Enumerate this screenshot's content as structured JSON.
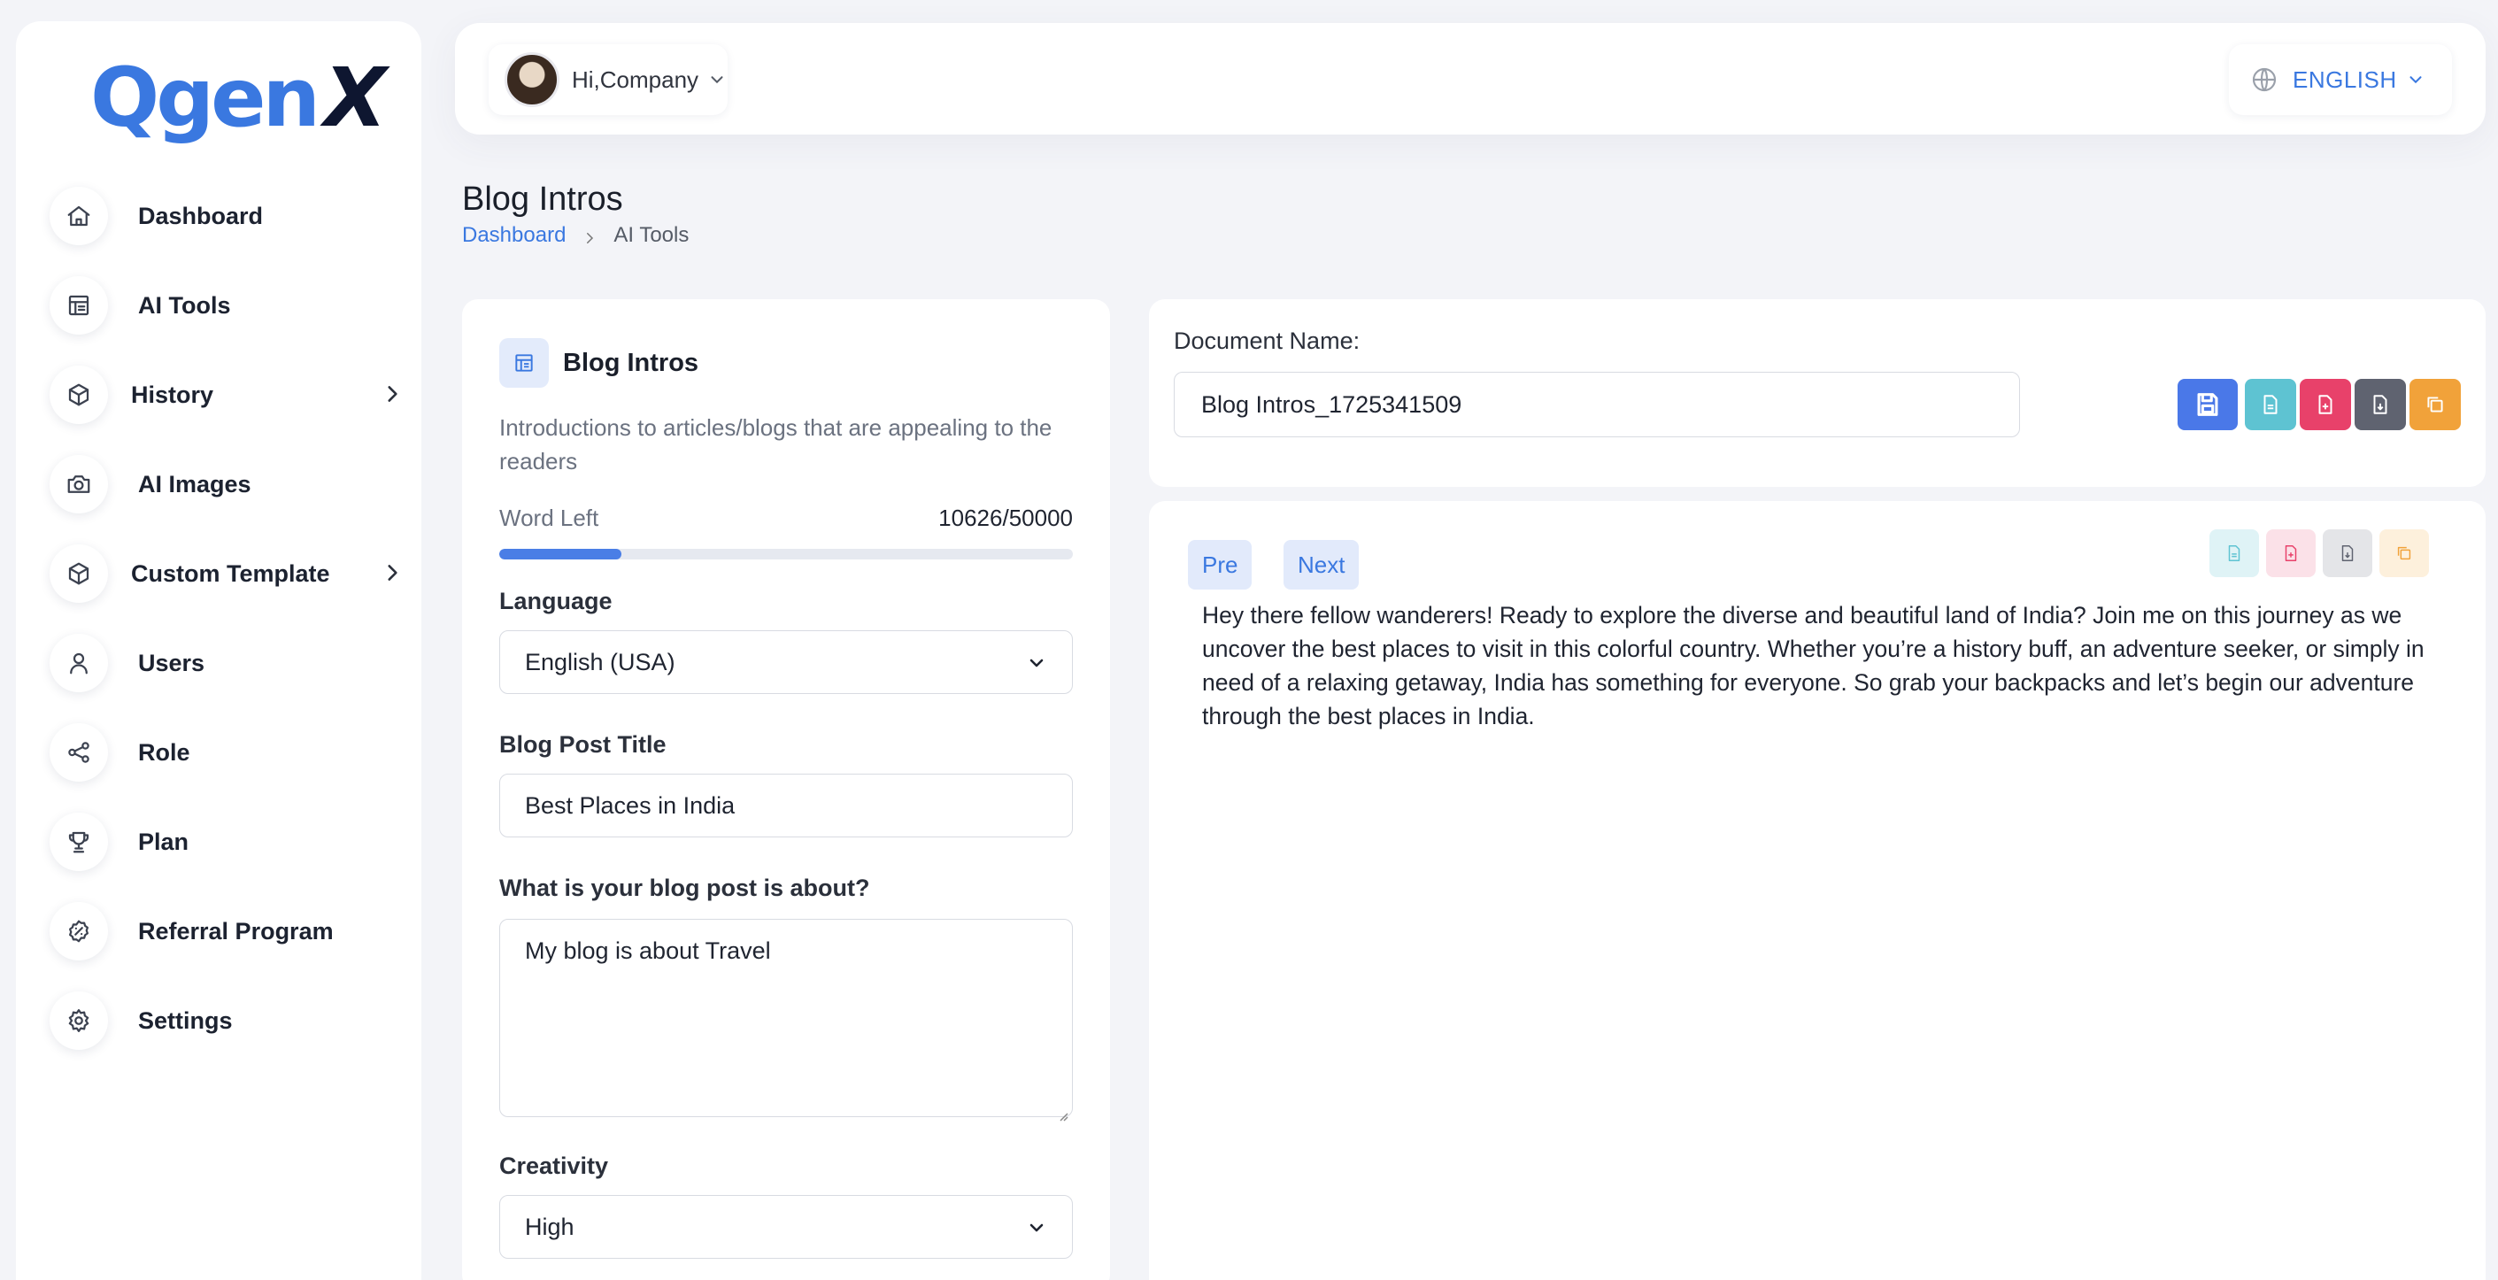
{
  "brand": {
    "logo_main": "Qgen",
    "logo_accent": "X"
  },
  "sidebar": {
    "items": [
      {
        "label": "Dashboard",
        "icon": "home-icon"
      },
      {
        "label": "AI Tools",
        "icon": "tools-icon"
      },
      {
        "label": "History",
        "icon": "box-icon",
        "has_submenu": true
      },
      {
        "label": "AI Images",
        "icon": "camera-icon"
      },
      {
        "label": "Custom Template",
        "icon": "box-icon",
        "has_submenu": true
      },
      {
        "label": "Users",
        "icon": "user-icon"
      },
      {
        "label": "Role",
        "icon": "share-icon"
      },
      {
        "label": "Plan",
        "icon": "trophy-icon"
      },
      {
        "label": "Referral Program",
        "icon": "badge-icon"
      },
      {
        "label": "Settings",
        "icon": "gear-icon"
      }
    ]
  },
  "header": {
    "greeting": "Hi,Company",
    "language": "ENGLISH"
  },
  "page": {
    "title": "Blog Intros",
    "breadcrumb": {
      "link": "Dashboard",
      "current": "AI Tools"
    }
  },
  "form": {
    "tool_name": "Blog Intros",
    "description": "Introductions to articles/blogs that are appealing to the readers",
    "words_label": "Word Left",
    "words_value": "10626/50000",
    "words_used_fraction": 0.2125,
    "language_label": "Language",
    "language_value": "English (USA)",
    "title_label": "Blog Post Title",
    "title_value": "Best Places in India",
    "about_label": "What is your blog post is about?",
    "about_value": "My blog is about Travel",
    "creativity_label": "Creativity",
    "creativity_value": "High"
  },
  "document": {
    "name_label": "Document Name:",
    "name_value": "Blog Intros_1725341509"
  },
  "output": {
    "pre_label": "Pre",
    "next_label": "Next",
    "text": "Hey there fellow wanderers! Ready to explore the diverse and beautiful land of India? Join me on this journey as we uncover the best places to visit in this colorful country. Whether you’re a history buff, an adventure seeker, or simply in need of a relaxing getaway, India has something for everyone. So grab your backpacks and let’s begin our adventure through the best places in India."
  },
  "colors": {
    "accent": "#3a78e0",
    "save": "#4a78e8",
    "doc_teal": "#5ec3d2",
    "pdf_red": "#e8416a",
    "dark_gray": "#5f6370",
    "copy_orange": "#f1a23a"
  }
}
